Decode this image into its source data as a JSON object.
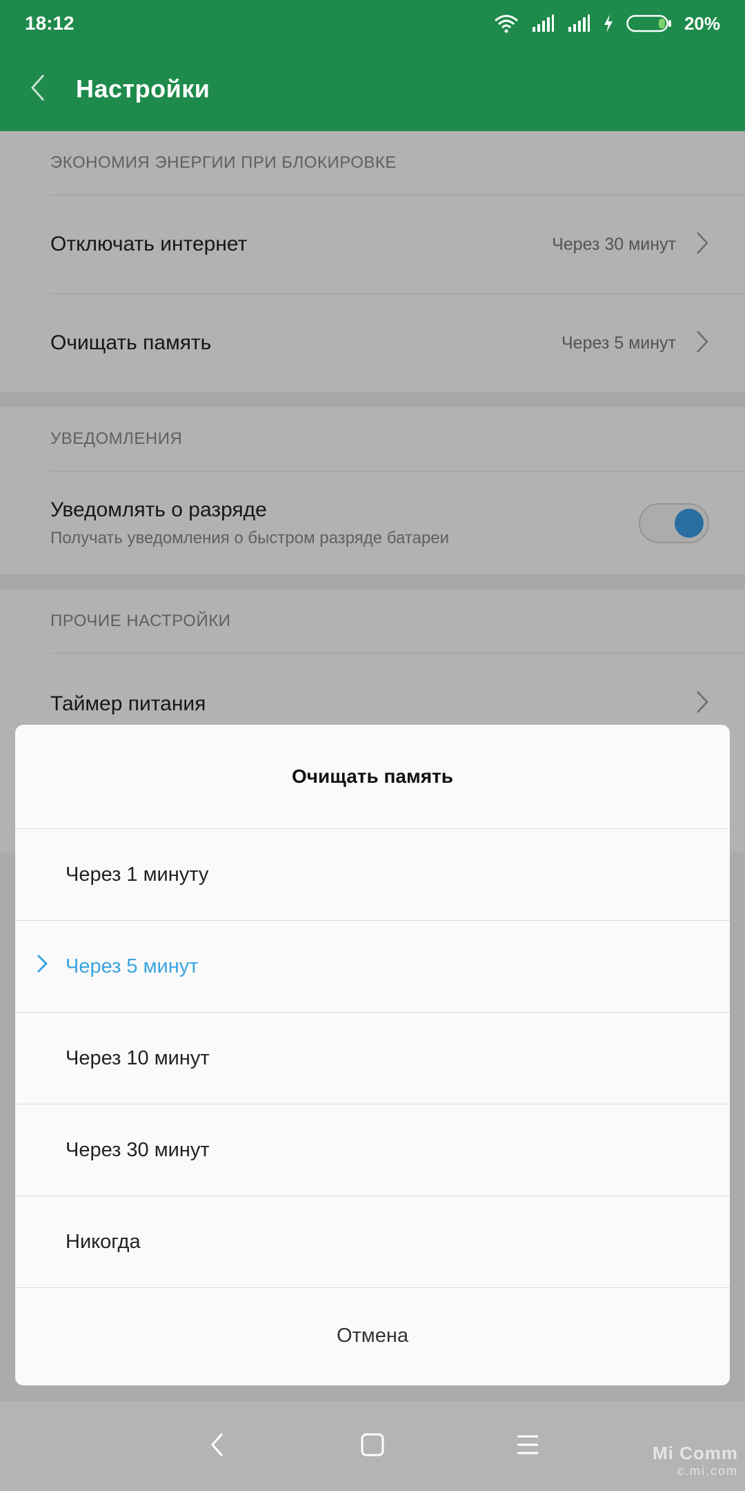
{
  "status_bar": {
    "time": "18:12",
    "battery": "20%",
    "icons": [
      "wifi-icon",
      "signal-icon",
      "signal-icon",
      "charging-icon",
      "battery-icon"
    ]
  },
  "header": {
    "title": "Настройки",
    "back_icon": "chevron-left-icon"
  },
  "sections": {
    "power_saving": {
      "header": "ЭКОНОМИЯ ЭНЕРГИИ ПРИ БЛОКИРОВКЕ",
      "rows": [
        {
          "title": "Отключать интернет",
          "value": "Через 30 минут"
        },
        {
          "title": "Очищать память",
          "value": "Через 5 минут"
        }
      ]
    },
    "notifications": {
      "header": "УВЕДОМЛЕНИЯ",
      "row": {
        "title": "Уведомлять о разряде",
        "subtitle": "Получать уведомления о быстром разряде батареи",
        "toggle_on": true
      }
    },
    "other": {
      "header": "ПРОЧИЕ НАСТРОЙКИ",
      "rows": [
        {
          "title": "Таймер питания"
        }
      ]
    }
  },
  "dialog": {
    "title": "Очищать память",
    "options": [
      {
        "label": "Через 1 минуту",
        "selected": false
      },
      {
        "label": "Через 5 минут",
        "selected": true
      },
      {
        "label": "Через 10 минут",
        "selected": false
      },
      {
        "label": "Через 30 минут",
        "selected": false
      },
      {
        "label": "Никогда",
        "selected": false
      }
    ],
    "cancel": "Отмена"
  },
  "colors": {
    "brand_green": "#1e8a4b",
    "accent_blue": "#3aa3e0",
    "toggle_on": "#3c9ee6"
  },
  "watermark": {
    "main": "Mi Comm",
    "sub": "c.mi.com"
  }
}
